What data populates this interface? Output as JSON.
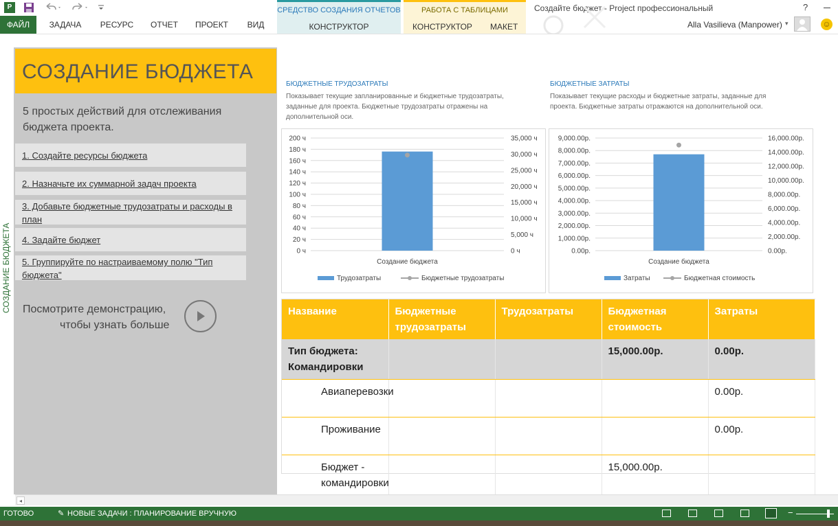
{
  "window": {
    "title": "Создайте бюджет - Project профессиональный",
    "help": "?",
    "user": "Alla Vasilieva (Manpower)"
  },
  "ribbon": {
    "file": "ФАЙЛ",
    "tabs": [
      "ЗАДАЧА",
      "РЕСУРС",
      "ОТЧЕТ",
      "ПРОЕКТ",
      "ВИД"
    ],
    "context_report": {
      "title": "СРЕДСТВО СОЗДАНИЯ ОТЧЕТОВ",
      "tab": "КОНСТРУКТОР",
      "color": "#2a79b9",
      "bg": "#ddeeee"
    },
    "context_table": {
      "title": "РАБОТА С ТАБЛИЦАМИ",
      "tab1": "КОНСТРУКТОР",
      "tab2": "МАКЕТ",
      "color": "#7a6a00",
      "bg": "#fdf3d0"
    }
  },
  "sidebar_label": "СОЗДАНИЕ БЮДЖЕТА",
  "left": {
    "heading": "СОЗДАНИЕ БЮДЖЕТА",
    "intro": "5 простых действий для отслеживания бюджета проекта.",
    "steps": [
      "1. Создайте ресурсы бюджета",
      "2. Назначьте их суммарной задач проекта",
      "3. Добавьте бюджетные трудозатраты и расходы в план",
      "4. Задайте бюджет",
      "5. Группируйте по настраиваемому полю \"Тип бюджета\""
    ],
    "demo_line1": "Посмотрите демонстрацию,",
    "demo_line2": "чтобы узнать больше"
  },
  "chart_work": {
    "heading": "БЮДЖЕТНЫЕ ТРУДОЗАТРАТЫ",
    "description_lines": [
      "Показывает текущие запланированные и бюджетные трудозатраты,",
      "заданные для проекта. Бюджетные трудозатраты отражены на",
      "дополнительной оси."
    ]
  },
  "chart_cost": {
    "heading": "БЮДЖЕТНЫЕ ЗАТРАТЫ",
    "description_lines": [
      "Показывает текущие расходы и бюджетные затраты, заданные для",
      "проекта. Бюджетные затраты отражаются на дополнительной оси."
    ]
  },
  "chart_data": [
    {
      "type": "bar",
      "categories": [
        "Создание бюджета"
      ],
      "series": [
        {
          "name": "Трудозатраты",
          "values": [
            176
          ],
          "axis": "primary",
          "color": "#5b9bd5"
        },
        {
          "name": "Бюджетные трудозатраты",
          "values": [
            29700
          ],
          "axis": "secondary",
          "color": "#a5a5a5",
          "marker": "point"
        }
      ],
      "ylim": [
        0,
        200
      ],
      "y2lim": [
        0,
        35000
      ],
      "yticks": [
        "0 ч",
        "20 ч",
        "40 ч",
        "60 ч",
        "80 ч",
        "100 ч",
        "120 ч",
        "140 ч",
        "160 ч",
        "180 ч",
        "200 ч"
      ],
      "y2ticks": [
        "0 ч",
        "5,000 ч",
        "10,000 ч",
        "15,000 ч",
        "20,000 ч",
        "25,000 ч",
        "30,000 ч",
        "35,000 ч"
      ],
      "legend": "bottom",
      "grid": true
    },
    {
      "type": "bar",
      "categories": [
        "Создание бюджета"
      ],
      "series": [
        {
          "name": "Затраты",
          "values": [
            7700
          ],
          "axis": "primary",
          "color": "#5b9bd5"
        },
        {
          "name": "Бюджетная стоимость",
          "values": [
            15000
          ],
          "axis": "secondary",
          "color": "#a5a5a5",
          "marker": "point"
        }
      ],
      "ylim": [
        0,
        9000
      ],
      "y2lim": [
        0,
        16000
      ],
      "yticks": [
        "0.00р.",
        "1,000.00р.",
        "2,000.00р.",
        "3,000.00р.",
        "4,000.00р.",
        "5,000.00р.",
        "6,000.00р.",
        "7,000.00р.",
        "8,000.00р.",
        "9,000.00р."
      ],
      "y2ticks": [
        "0.00р.",
        "2,000.00р.",
        "4,000.00р.",
        "6,000.00р.",
        "8,000.00р.",
        "10,000.00р.",
        "12,000.00р.",
        "14,000.00р.",
        "16,000.00р."
      ],
      "legend": "bottom",
      "grid": true
    }
  ],
  "table": {
    "headers": [
      "Название",
      "Бюджетные трудозатраты",
      "Трудозатраты",
      "Бюджетная стоимость",
      "Затраты"
    ],
    "rows": [
      {
        "group": true,
        "cells": [
          "Тип бюджета: Командировки",
          "",
          "",
          "15,000.00р.",
          "0.00р."
        ]
      },
      {
        "group": false,
        "cells": [
          "Авиаперевозки",
          "",
          "",
          "",
          "0.00р."
        ]
      },
      {
        "group": false,
        "cells": [
          "Проживание",
          "",
          "",
          "",
          "0.00р."
        ]
      },
      {
        "group": false,
        "cells": [
          "Бюджет - командировки",
          "",
          "",
          "15,000.00р.",
          ""
        ]
      }
    ]
  },
  "status": {
    "ready": "ГОТОВО",
    "new_tasks": "НОВЫЕ ЗАДАЧИ : ПЛАНИРОВАНИЕ ВРУЧНУЮ"
  },
  "colors": {
    "accent_green": "#2e7237",
    "yellow": "#fec00f",
    "bar_blue": "#5b9bd5"
  }
}
